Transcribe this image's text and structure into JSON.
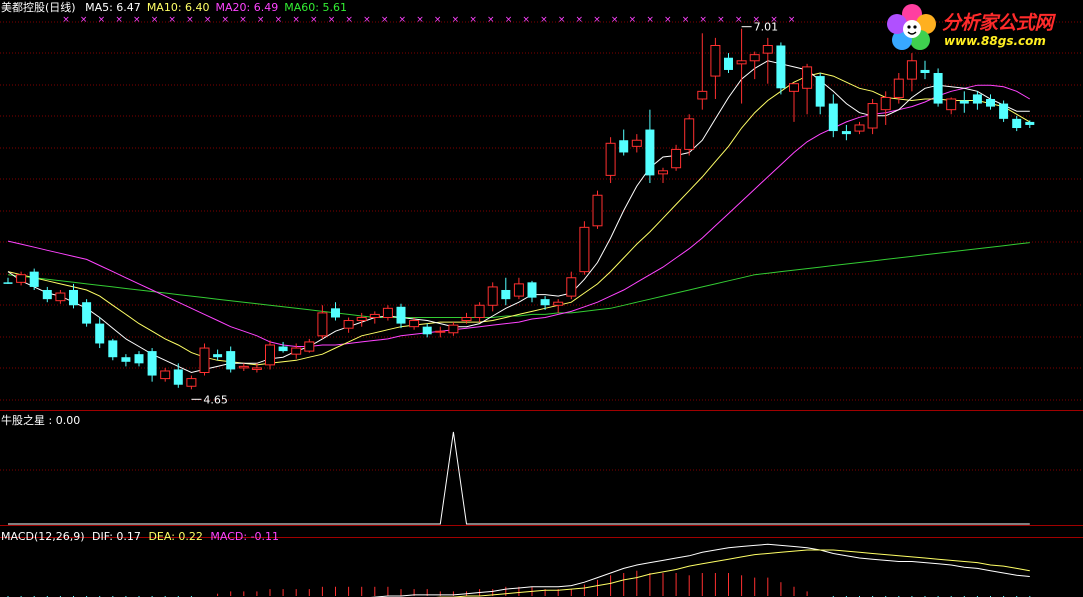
{
  "header": {
    "title": "美都控股(日线)",
    "ma": [
      {
        "label": "MA5: 6.47",
        "color": "#ffffff"
      },
      {
        "label": "MA10: 6.40",
        "color": "#ffff66"
      },
      {
        "label": "MA20: 6.49",
        "color": "#ff44ff"
      },
      {
        "label": "MA60: 5.61",
        "color": "#33ee33"
      }
    ]
  },
  "indicator": {
    "label": "牛股之星 : 0.00"
  },
  "macd": {
    "name": "MACD(12,26,9)",
    "dif": "DIF: 0.17",
    "dea": "DEA: 0.22",
    "macd": "MACD: -0.11"
  },
  "logo": {
    "text": "分析家公式网",
    "url": "www.88gs.com"
  },
  "colors": {
    "up": "#ff3030",
    "down": "#54ffff",
    "ma5": "#ffffff",
    "ma10": "#ffff66",
    "ma20": "#ff44ff",
    "ma60": "#33cc33",
    "grid": "#800000",
    "border": "#a00000"
  },
  "chart_data": {
    "type": "candlestick",
    "annotations": [
      {
        "text": "7.01",
        "type": "high"
      },
      {
        "text": "4.65",
        "type": "low"
      }
    ],
    "candles": [
      [
        5.35,
        5.38,
        5.34,
        5.34
      ],
      [
        5.35,
        5.42,
        5.33,
        5.4
      ],
      [
        5.42,
        5.44,
        5.3,
        5.32
      ],
      [
        5.3,
        5.32,
        5.22,
        5.24
      ],
      [
        5.23,
        5.3,
        5.21,
        5.28
      ],
      [
        5.3,
        5.34,
        5.18,
        5.2
      ],
      [
        5.22,
        5.24,
        5.06,
        5.08
      ],
      [
        5.08,
        5.12,
        4.92,
        4.95
      ],
      [
        4.97,
        4.98,
        4.84,
        4.86
      ],
      [
        4.86,
        4.88,
        4.8,
        4.83
      ],
      [
        4.88,
        4.9,
        4.8,
        4.82
      ],
      [
        4.9,
        4.92,
        4.7,
        4.74
      ],
      [
        4.72,
        4.79,
        4.7,
        4.77
      ],
      [
        4.78,
        4.82,
        4.66,
        4.68
      ],
      [
        4.67,
        4.74,
        4.65,
        4.72
      ],
      [
        4.76,
        4.95,
        4.74,
        4.92
      ],
      [
        4.88,
        4.91,
        4.84,
        4.86
      ],
      [
        4.9,
        4.93,
        4.76,
        4.78
      ],
      [
        4.79,
        4.82,
        4.77,
        4.8
      ],
      [
        4.78,
        4.82,
        4.76,
        4.79
      ],
      [
        4.81,
        4.97,
        4.78,
        4.94
      ],
      [
        4.93,
        4.96,
        4.89,
        4.9
      ],
      [
        4.88,
        4.95,
        4.85,
        4.92
      ],
      [
        4.9,
        4.98,
        4.89,
        4.96
      ],
      [
        5.0,
        5.2,
        4.98,
        5.15
      ],
      [
        5.18,
        5.22,
        5.1,
        5.12
      ],
      [
        5.05,
        5.12,
        5.02,
        5.1
      ],
      [
        5.1,
        5.15,
        5.06,
        5.12
      ],
      [
        5.12,
        5.16,
        5.08,
        5.14
      ],
      [
        5.12,
        5.2,
        5.1,
        5.18
      ],
      [
        5.19,
        5.21,
        5.05,
        5.08
      ],
      [
        5.06,
        5.12,
        5.04,
        5.1
      ],
      [
        5.06,
        5.08,
        4.99,
        5.01
      ],
      [
        5.03,
        5.06,
        4.99,
        5.03
      ],
      [
        5.02,
        5.09,
        5.0,
        5.07
      ],
      [
        5.1,
        5.15,
        5.08,
        5.12
      ],
      [
        5.12,
        5.22,
        5.09,
        5.2
      ],
      [
        5.2,
        5.35,
        5.16,
        5.32
      ],
      [
        5.3,
        5.38,
        5.2,
        5.24
      ],
      [
        5.26,
        5.38,
        5.24,
        5.34
      ],
      [
        5.35,
        5.36,
        5.22,
        5.25
      ],
      [
        5.24,
        5.26,
        5.17,
        5.2
      ],
      [
        5.2,
        5.24,
        5.15,
        5.22
      ],
      [
        5.26,
        5.42,
        5.24,
        5.38
      ],
      [
        5.42,
        5.75,
        5.4,
        5.71
      ],
      [
        5.72,
        5.95,
        5.7,
        5.92
      ],
      [
        6.05,
        6.3,
        6.0,
        6.26
      ],
      [
        6.28,
        6.35,
        6.18,
        6.2
      ],
      [
        6.24,
        6.32,
        6.2,
        6.28
      ],
      [
        6.35,
        6.48,
        6.0,
        6.05
      ],
      [
        6.06,
        6.1,
        6.0,
        6.08
      ],
      [
        6.1,
        6.25,
        6.08,
        6.22
      ],
      [
        6.22,
        6.45,
        6.18,
        6.42
      ],
      [
        6.55,
        6.98,
        6.48,
        6.6
      ],
      [
        6.7,
        6.95,
        6.55,
        6.9
      ],
      [
        6.82,
        6.85,
        6.72,
        6.74
      ],
      [
        6.78,
        7.01,
        6.52,
        6.8
      ],
      [
        6.8,
        6.86,
        6.68,
        6.84
      ],
      [
        6.85,
        6.95,
        6.65,
        6.9
      ],
      [
        6.9,
        6.92,
        6.58,
        6.62
      ],
      [
        6.6,
        6.65,
        6.4,
        6.65
      ],
      [
        6.62,
        6.78,
        6.45,
        6.76
      ],
      [
        6.7,
        6.72,
        6.45,
        6.5
      ],
      [
        6.52,
        6.58,
        6.3,
        6.34
      ],
      [
        6.34,
        6.38,
        6.28,
        6.32
      ],
      [
        6.34,
        6.4,
        6.32,
        6.38
      ],
      [
        6.36,
        6.55,
        6.32,
        6.52
      ],
      [
        6.48,
        6.6,
        6.38,
        6.56
      ],
      [
        6.56,
        6.72,
        6.52,
        6.68
      ],
      [
        6.68,
        6.85,
        6.6,
        6.8
      ],
      [
        6.74,
        6.8,
        6.68,
        6.72
      ],
      [
        6.72,
        6.75,
        6.5,
        6.52
      ],
      [
        6.48,
        6.56,
        6.45,
        6.55
      ],
      [
        6.54,
        6.6,
        6.46,
        6.52
      ],
      [
        6.58,
        6.6,
        6.48,
        6.52
      ],
      [
        6.55,
        6.58,
        6.48,
        6.5
      ],
      [
        6.52,
        6.54,
        6.4,
        6.42
      ],
      [
        6.42,
        6.44,
        6.34,
        6.36
      ],
      [
        6.4,
        6.41,
        6.36,
        6.38
      ]
    ],
    "ma5": [
      5.42,
      5.36,
      5.32,
      5.28,
      5.26,
      5.22,
      5.18,
      5.12,
      5.05,
      4.98,
      4.93,
      4.88,
      4.84,
      4.8,
      4.76,
      4.78,
      4.8,
      4.82,
      4.82,
      4.82,
      4.85,
      4.86,
      4.9,
      4.93,
      4.98,
      5.03,
      5.06,
      5.09,
      5.12,
      5.13,
      5.12,
      5.11,
      5.1,
      5.08,
      5.06,
      5.06,
      5.08,
      5.13,
      5.18,
      5.22,
      5.27,
      5.27,
      5.26,
      5.28,
      5.37,
      5.48,
      5.64,
      5.82,
      5.98,
      6.1,
      6.17,
      6.18,
      6.2,
      6.28,
      6.42,
      6.56,
      6.68,
      6.75,
      6.8,
      6.78,
      6.76,
      6.74,
      6.67,
      6.6,
      6.52,
      6.46,
      6.44,
      6.44,
      6.48,
      6.56,
      6.62,
      6.64,
      6.63,
      6.62,
      6.6,
      6.55,
      6.51,
      6.47,
      6.47
    ],
    "ma10": [
      5.42,
      5.4,
      5.38,
      5.36,
      5.34,
      5.32,
      5.3,
      5.26,
      5.2,
      5.14,
      5.08,
      5.03,
      4.98,
      4.94,
      4.89,
      4.86,
      4.84,
      4.83,
      4.82,
      4.81,
      4.82,
      4.83,
      4.84,
      4.86,
      4.88,
      4.92,
      4.96,
      5.0,
      5.02,
      5.04,
      5.06,
      5.07,
      5.08,
      5.09,
      5.09,
      5.09,
      5.09,
      5.1,
      5.12,
      5.14,
      5.16,
      5.18,
      5.2,
      5.22,
      5.28,
      5.34,
      5.42,
      5.51,
      5.6,
      5.68,
      5.77,
      5.86,
      5.95,
      6.04,
      6.14,
      6.24,
      6.36,
      6.46,
      6.54,
      6.6,
      6.66,
      6.7,
      6.72,
      6.7,
      6.66,
      6.62,
      6.6,
      6.56,
      6.55,
      6.54,
      6.55,
      6.55,
      6.54,
      6.54,
      6.54,
      6.52,
      6.5,
      6.45,
      6.4
    ],
    "ma20": [
      5.62,
      5.6,
      5.58,
      5.56,
      5.54,
      5.52,
      5.5,
      5.46,
      5.42,
      5.38,
      5.34,
      5.3,
      5.26,
      5.22,
      5.18,
      5.14,
      5.1,
      5.06,
      5.03,
      5.0,
      4.96,
      4.94,
      4.93,
      4.93,
      4.94,
      4.94,
      4.95,
      4.96,
      4.97,
      4.98,
      5.0,
      5.01,
      5.02,
      5.03,
      5.04,
      5.05,
      5.06,
      5.07,
      5.08,
      5.09,
      5.11,
      5.12,
      5.14,
      5.16,
      5.19,
      5.22,
      5.26,
      5.3,
      5.35,
      5.4,
      5.45,
      5.51,
      5.57,
      5.64,
      5.72,
      5.8,
      5.88,
      5.96,
      6.04,
      6.12,
      6.2,
      6.27,
      6.32,
      6.36,
      6.4,
      6.43,
      6.45,
      6.46,
      6.48,
      6.5,
      6.53,
      6.57,
      6.6,
      6.62,
      6.64,
      6.64,
      6.63,
      6.6,
      6.55
    ],
    "ma60": [
      5.4,
      5.39,
      5.38,
      5.37,
      5.36,
      5.35,
      5.34,
      5.33,
      5.32,
      5.31,
      5.3,
      5.29,
      5.28,
      5.27,
      5.26,
      5.25,
      5.24,
      5.23,
      5.22,
      5.21,
      5.2,
      5.19,
      5.18,
      5.17,
      5.16,
      5.15,
      5.14,
      5.13,
      5.12,
      5.12,
      5.12,
      5.12,
      5.12,
      5.12,
      5.12,
      5.12,
      5.12,
      5.12,
      5.13,
      5.13,
      5.14,
      5.14,
      5.15,
      5.15,
      5.16,
      5.17,
      5.18,
      5.2,
      5.22,
      5.24,
      5.26,
      5.28,
      5.3,
      5.32,
      5.34,
      5.36,
      5.38,
      5.4,
      5.41,
      5.42,
      5.43,
      5.44,
      5.45,
      5.46,
      5.47,
      5.48,
      5.49,
      5.5,
      5.51,
      5.52,
      5.53,
      5.54,
      5.55,
      5.56,
      5.57,
      5.58,
      5.59,
      5.6,
      5.61
    ],
    "indicator": [
      0,
      0,
      0,
      0,
      0,
      0,
      0,
      0,
      0,
      0,
      0,
      0,
      0,
      0,
      0,
      0,
      0,
      0,
      0,
      0,
      0,
      0,
      0,
      0,
      0,
      0,
      0,
      0,
      0,
      0,
      0,
      0,
      0,
      0,
      1,
      0,
      0,
      0,
      0,
      0,
      0,
      0,
      0,
      0,
      0,
      0,
      0,
      0,
      0,
      0,
      0,
      0,
      0,
      0,
      0,
      0,
      0,
      0,
      0,
      0,
      0,
      0,
      0,
      0,
      0,
      0,
      0,
      0,
      0,
      0,
      0,
      0,
      0,
      0,
      0,
      0,
      0,
      0,
      0
    ],
    "dif": [
      -0.08,
      -0.09,
      -0.1,
      -0.11,
      -0.12,
      -0.13,
      -0.14,
      -0.15,
      -0.16,
      -0.17,
      -0.18,
      -0.19,
      -0.19,
      -0.19,
      -0.18,
      -0.16,
      -0.15,
      -0.14,
      -0.13,
      -0.12,
      -0.1,
      -0.09,
      -0.08,
      -0.07,
      -0.05,
      -0.04,
      -0.03,
      -0.02,
      -0.01,
      0.0,
      0.0,
      0.01,
      0.01,
      0.01,
      0.01,
      0.02,
      0.03,
      0.04,
      0.06,
      0.07,
      0.08,
      0.08,
      0.08,
      0.09,
      0.12,
      0.16,
      0.2,
      0.24,
      0.27,
      0.29,
      0.31,
      0.33,
      0.35,
      0.38,
      0.4,
      0.42,
      0.43,
      0.44,
      0.45,
      0.44,
      0.43,
      0.42,
      0.4,
      0.37,
      0.35,
      0.33,
      0.32,
      0.31,
      0.3,
      0.3,
      0.29,
      0.28,
      0.27,
      0.25,
      0.24,
      0.22,
      0.2,
      0.18,
      0.17
    ],
    "dea": [
      -0.07,
      -0.07,
      -0.08,
      -0.08,
      -0.09,
      -0.1,
      -0.1,
      -0.11,
      -0.12,
      -0.13,
      -0.14,
      -0.15,
      -0.15,
      -0.16,
      -0.16,
      -0.16,
      -0.16,
      -0.16,
      -0.15,
      -0.14,
      -0.13,
      -0.12,
      -0.11,
      -0.1,
      -0.09,
      -0.08,
      -0.07,
      -0.06,
      -0.05,
      -0.04,
      -0.03,
      -0.02,
      -0.02,
      -0.01,
      -0.01,
      0.0,
      0.0,
      0.01,
      0.02,
      0.03,
      0.04,
      0.05,
      0.05,
      0.06,
      0.07,
      0.09,
      0.11,
      0.14,
      0.16,
      0.19,
      0.21,
      0.23,
      0.26,
      0.28,
      0.3,
      0.32,
      0.34,
      0.36,
      0.37,
      0.38,
      0.39,
      0.4,
      0.4,
      0.4,
      0.39,
      0.38,
      0.37,
      0.36,
      0.35,
      0.34,
      0.33,
      0.32,
      0.31,
      0.3,
      0.29,
      0.27,
      0.26,
      0.24,
      0.22
    ]
  }
}
